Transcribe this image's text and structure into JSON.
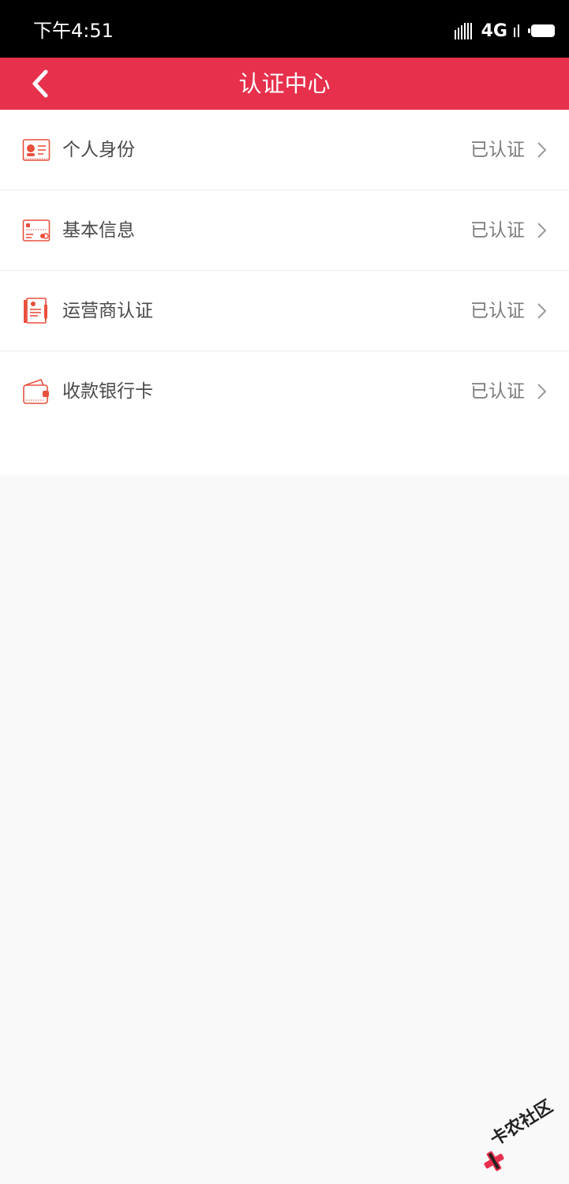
{
  "status_bar": {
    "time": "下午4:51",
    "network": "4G"
  },
  "nav": {
    "title": "认证中心",
    "back_icon": "chevron-left-icon"
  },
  "items": [
    {
      "label": "个人身份",
      "status": "已认证",
      "icon": "id-card-icon"
    },
    {
      "label": "基本信息",
      "status": "已认证",
      "icon": "info-card-icon"
    },
    {
      "label": "运营商认证",
      "status": "已认证",
      "icon": "carrier-contract-icon"
    },
    {
      "label": "收款银行卡",
      "status": "已认证",
      "icon": "wallet-icon"
    }
  ],
  "watermark": {
    "text": "卡农社区"
  },
  "colors": {
    "accent": "#e6304c",
    "icon": "#e8503e",
    "status_bar": "#000000",
    "page_bg": "#f9f9f9"
  }
}
